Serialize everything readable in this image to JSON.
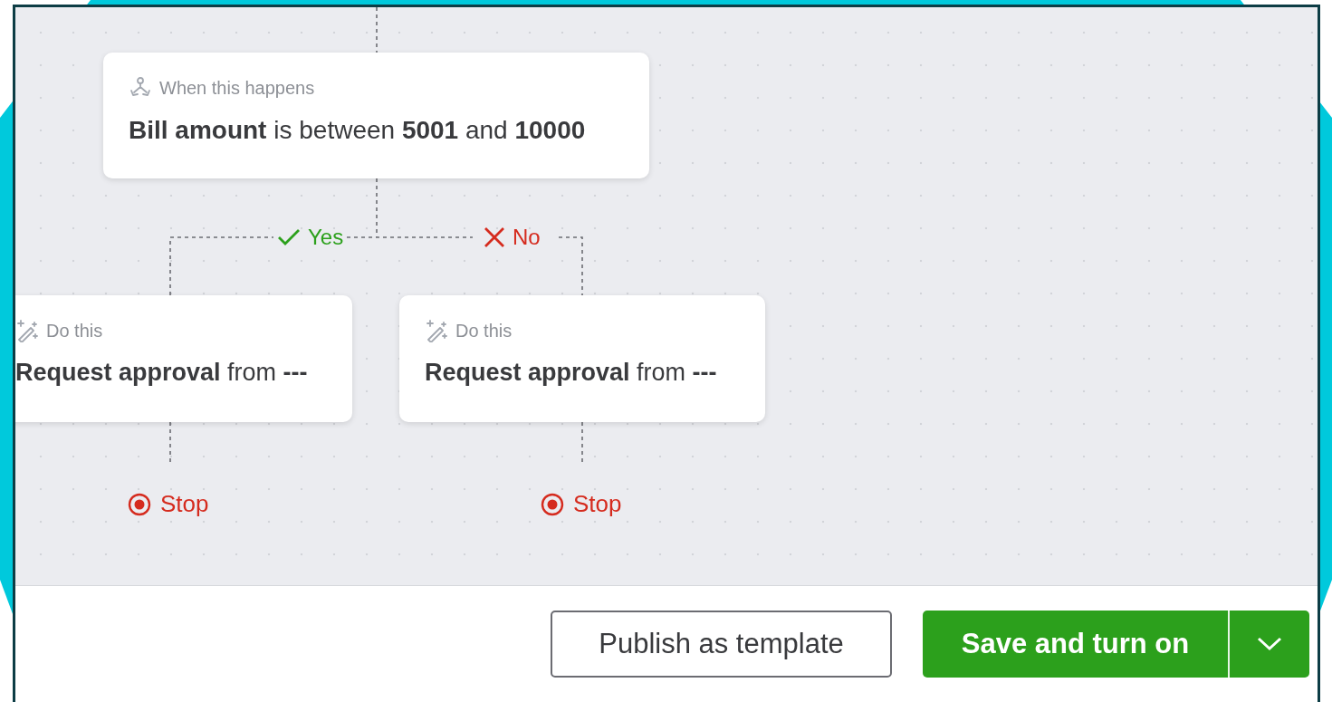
{
  "trigger": {
    "label": "When this happens",
    "condition": "**Bill amount** is between **5001** and **10000**"
  },
  "branches": [
    {
      "kind": "yes",
      "label": "Yes",
      "action": {
        "label": "Do this",
        "text": "**Request approval** from **---**"
      },
      "end": "Stop"
    },
    {
      "kind": "no",
      "label": "No",
      "action": {
        "label": "Do this",
        "text": "**Request approval** from **---**"
      },
      "end": "Stop"
    }
  ],
  "footer": {
    "buttons": [
      {
        "kind": "secondary",
        "label": "Publish as template",
        "has_menu": false
      },
      {
        "kind": "primary",
        "label": "Save and turn on",
        "has_menu": true
      }
    ]
  }
}
